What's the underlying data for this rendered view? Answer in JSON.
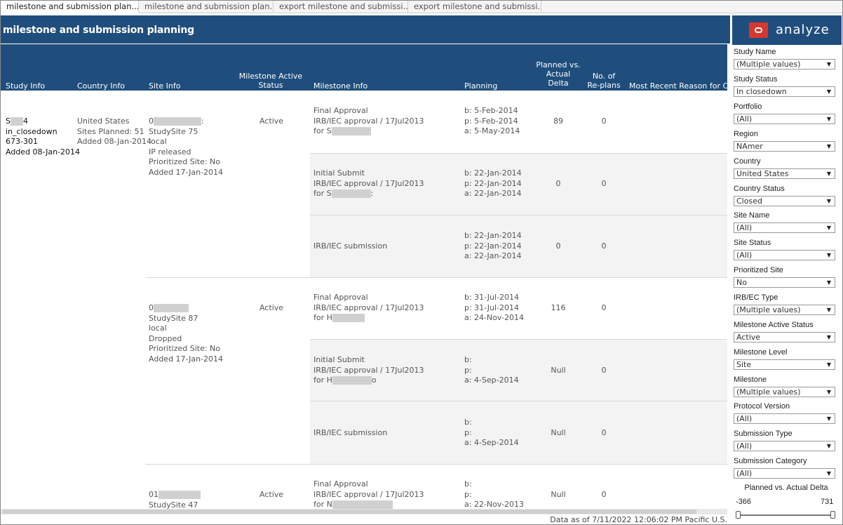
{
  "tabs": [
    {
      "label": "milestone and submission plan..."
    },
    {
      "label": "milestone and submission plan..."
    },
    {
      "label": "export milestone and submissi..."
    },
    {
      "label": "export milestone and submissi..."
    }
  ],
  "header": {
    "title": "milestone and submission planning"
  },
  "columns": {
    "study_info": "Study Info",
    "country_info": "Country Info",
    "site_info": "Site Info",
    "milestone_status": [
      "Milestone Active",
      "Status"
    ],
    "milestone_info": "Milestone Info",
    "planning": "Planning",
    "delta": [
      "Planned vs.",
      "Actual",
      "Delta"
    ],
    "replans": [
      "No. of",
      "Re-plans"
    ],
    "reason": "Most Recent Reason for Char"
  },
  "study": {
    "name_prefix": "S",
    "name_suffix": "4",
    "status": "in_closedown",
    "code": "673-301",
    "added": "Added 08-Jan-2014"
  },
  "country": {
    "name": "United States",
    "sites_planned": "Sites Planned: 51",
    "added": "Added 08-Jan-2014"
  },
  "sites": [
    {
      "id_prefix": "0",
      "id_suffix": ":",
      "name": "StudySite 75",
      "type": "local",
      "state": "IP released",
      "prioritized": "Prioritized Site: No",
      "added": "Added 17-Jan-2014",
      "status": "Active"
    },
    {
      "id_prefix": "0",
      "id_suffix": "",
      "name": "StudySite 87",
      "type": "local",
      "state": "Dropped",
      "prioritized": "Prioritized Site: No",
      "added": "Added 17-Jan-2014",
      "status": "Active"
    },
    {
      "id_prefix": "01",
      "id_suffix": "",
      "name": "StudySite 47",
      "status": "Active"
    }
  ],
  "milestones": [
    {
      "l1": "Final Approval",
      "l2": "IRB/IEC approval / 17Jul2013",
      "l3_prefix": "for S",
      "l3_suffix": "",
      "b": "b: 5-Feb-2014",
      "p": "p: 5-Feb-2014",
      "a": "a: 5-May-2014",
      "delta": "89",
      "replans": "0"
    },
    {
      "l1": "Initial Submit",
      "l2": "IRB/IEC approval / 17Jul2013",
      "l3_prefix": "for S",
      "l3_suffix": ":",
      "b": "b: 22-Jan-2014",
      "p": "p: 22-Jan-2014",
      "a": "a: 22-Jan-2014",
      "delta": "0",
      "replans": "0"
    },
    {
      "l1": "IRB/IEC submission",
      "b": "b: 22-Jan-2014",
      "p": "p: 22-Jan-2014",
      "a": "a: 22-Jan-2014",
      "delta": "0",
      "replans": "0"
    },
    {
      "l1": "Final Approval",
      "l2": "IRB/IEC approval / 17Jul2013",
      "l3_prefix": "for H",
      "l3_suffix": "",
      "b": "b: 31-Jul-2014",
      "p": "p: 31-Jul-2014",
      "a": "a: 24-Nov-2014",
      "delta": "116",
      "replans": "0"
    },
    {
      "l1": "Initial Submit",
      "l2": "IRB/IEC approval / 17Jul2013",
      "l3_prefix": "for H",
      "l3_suffix": "o",
      "b": "b:",
      "p": "p:",
      "a": "a: 4-Sep-2014",
      "delta": "Null",
      "replans": "0"
    },
    {
      "l1": "IRB/IEC submission",
      "b": "b:",
      "p": "p:",
      "a": "a: 4-Sep-2014",
      "delta": "Null",
      "replans": "0"
    },
    {
      "l1": "Final Approval",
      "l2": "IRB/IEC approval / 17Jul2013",
      "l3_prefix": "for N",
      "l3_suffix": "",
      "b": "b:",
      "p": "p:",
      "a": "a: 22-Nov-2013",
      "delta": "Null",
      "replans": "0"
    }
  ],
  "footer": "Data as of 7/11/2022 12:06:02 PM Pacific U.S.",
  "panel": {
    "brand": "analyze",
    "filters": [
      {
        "label": "Study Name",
        "value": "(Multiple values)"
      },
      {
        "label": "Study Status",
        "value": "In closedown"
      },
      {
        "label": "Portfolio",
        "value": "(All)"
      },
      {
        "label": "Region",
        "value": "NAmer"
      },
      {
        "label": "Country",
        "value": "United States"
      },
      {
        "label": "Country Status",
        "value": "Closed"
      },
      {
        "label": "Site Name",
        "value": "(All)"
      },
      {
        "label": "Site Status",
        "value": "(All)"
      },
      {
        "label": "Prioritized Site",
        "value": "No"
      },
      {
        "label": "IRB/EC Type",
        "value": "(Multiple values)"
      },
      {
        "label": "Milestone Active Status",
        "value": "Active"
      },
      {
        "label": "Milestone Level",
        "value": "Site"
      },
      {
        "label": "Milestone",
        "value": "(Multiple values)"
      },
      {
        "label": "Protocol Version",
        "value": "(All)"
      },
      {
        "label": "Submission Type",
        "value": "(All)"
      },
      {
        "label": "Submission Category",
        "value": "(All)"
      }
    ],
    "slider": {
      "label": "Planned vs. Actual Delta",
      "min": "-366",
      "max": "731"
    }
  }
}
